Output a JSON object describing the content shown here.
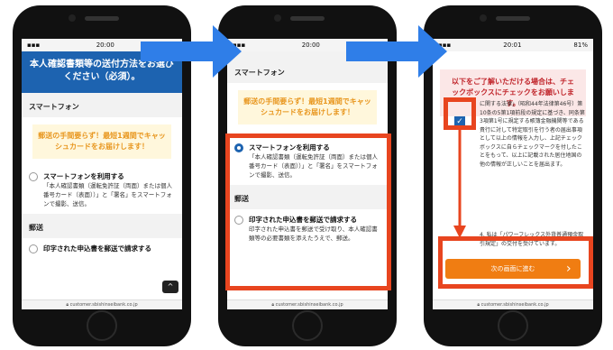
{
  "phones": [
    {
      "status": {
        "time": "20:00",
        "battery": "",
        "carrier": ""
      },
      "url": "customer.sbishinseibank.co.jp",
      "banner": "本人確認書類等の送付方法をお選びください（必須）。",
      "section_smartphone": "スマートフォン",
      "notice": "郵送の手間要らず！最短1週間でキャッシュカードをお届けします！",
      "option1_title": "スマートフォンを利用する",
      "option1_desc": "「本人確認書類（運転免許証（両面）または個人番号カード（表面））」と「署名」をスマートフォンで撮影、送信。",
      "section_mail": "郵送",
      "option2_title": "印字された申込書を郵送で請求する",
      "back_top": "^"
    },
    {
      "status": {
        "time": "20:00"
      },
      "url": "customer.sbishinseibank.co.jp",
      "section_smartphone": "スマートフォン",
      "notice": "郵送の手間要らず！最短1週間でキャッシュカードをお届けします！",
      "option1_title": "スマートフォンを利用する",
      "option1_desc": "「本人確認書類（運転免許証（両面）または個人番号カード（表面））」と「署名」をスマートフォンで撮影、送信。",
      "section_mail": "郵送",
      "option2_title": "印字された申込書を郵送で請求する",
      "option2_desc": "印字された申込書を郵送で受け取り、本人確認書類等の必要書類を添えたうえで、郵送。"
    },
    {
      "status": {
        "time": "20:01",
        "battery": "81%"
      },
      "url": "customer.sbishinseibank.co.jp",
      "warning": "以下をご了解いただける場合は、チェックボックスにチェックをお願いします。",
      "terms": "に関する法律」（昭和44年法律第46号）第10条の5第1項前段の規定に基づき、同条第3項第1号に規定する帳簿金融機関等である貴行に対して特定取引を行う者の届出事項として以上の情報を入力し、上記チェックボックスに自らチェックマークを付したことをもって、以上に記載された居住地国の他の情報が正しいことを届出ます。",
      "term4": "4. 私は「パワーフレックス外貨普通預金取引規定」の交付を受けています。",
      "check_mark": "✓",
      "next_button": "次の画面に進む",
      "next_arrow": "›"
    }
  ],
  "colors": {
    "arrow": "#2f7ee8",
    "highlight": "#e8451f",
    "brand_blue": "#1d63b0",
    "button_orange": "#f07d12"
  }
}
